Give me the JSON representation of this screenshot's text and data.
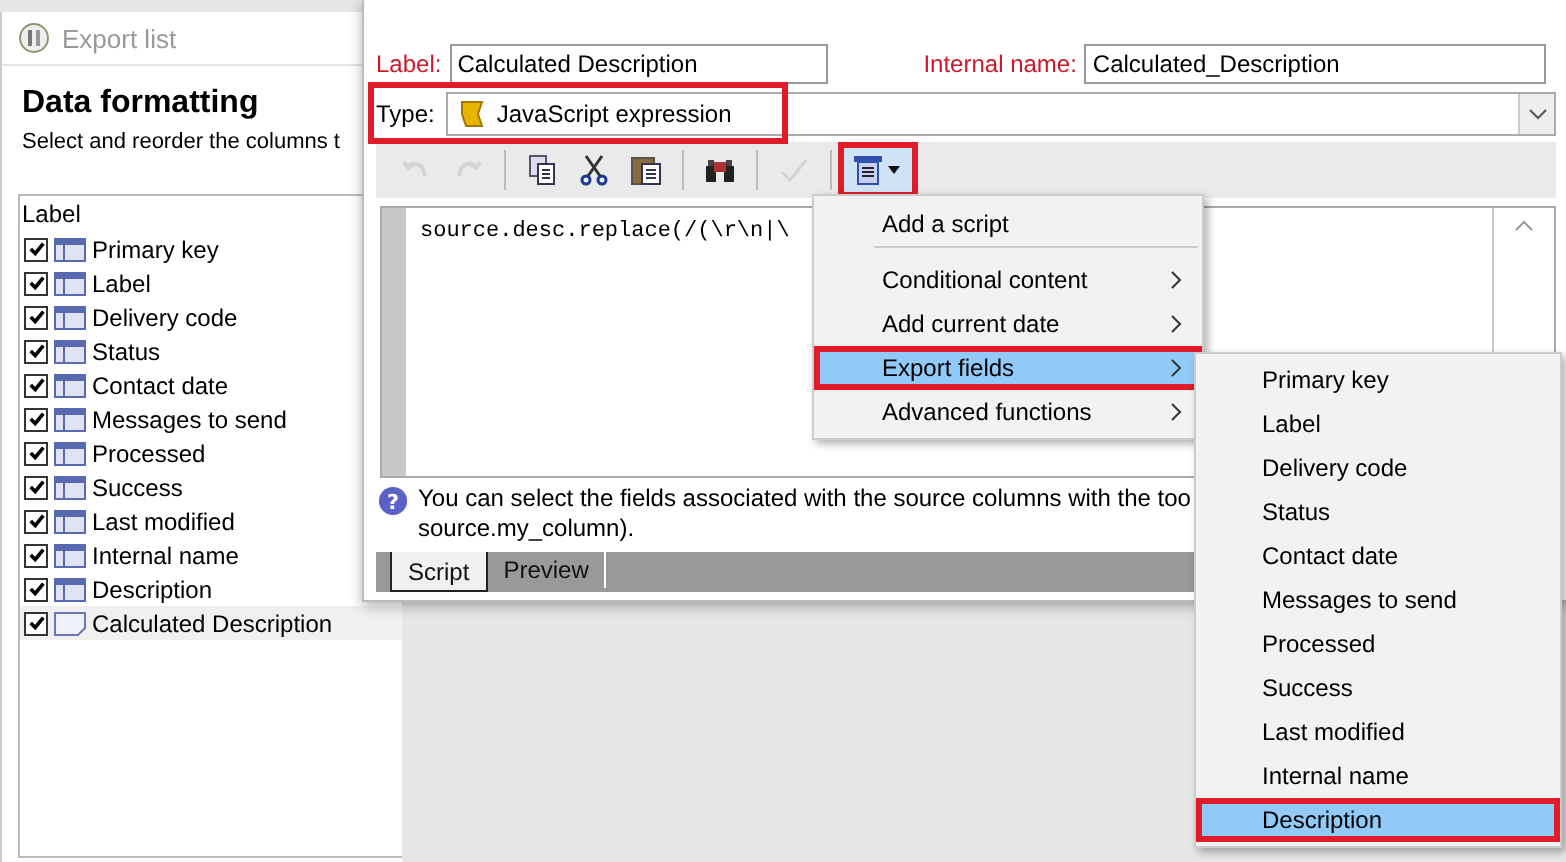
{
  "export_list": {
    "title": "Export list",
    "heading": "Data formatting",
    "subtitle": "Select and reorder the columns t",
    "column_header": "Label",
    "columns": [
      {
        "label": "Primary key",
        "checked": true,
        "kind": "column",
        "selected": false
      },
      {
        "label": "Label",
        "checked": true,
        "kind": "column",
        "selected": false
      },
      {
        "label": "Delivery code",
        "checked": true,
        "kind": "column",
        "selected": false
      },
      {
        "label": "Status",
        "checked": true,
        "kind": "column",
        "selected": false
      },
      {
        "label": "Contact date",
        "checked": true,
        "kind": "column",
        "selected": false
      },
      {
        "label": "Messages to send",
        "checked": true,
        "kind": "column",
        "selected": false
      },
      {
        "label": "Processed",
        "checked": true,
        "kind": "column",
        "selected": false
      },
      {
        "label": "Success",
        "checked": true,
        "kind": "column",
        "selected": false
      },
      {
        "label": "Last modified",
        "checked": true,
        "kind": "column",
        "selected": false
      },
      {
        "label": "Internal name",
        "checked": true,
        "kind": "column",
        "selected": false
      },
      {
        "label": "Description",
        "checked": true,
        "kind": "column",
        "selected": false
      },
      {
        "label": "Calculated Description",
        "checked": true,
        "kind": "calculated",
        "selected": true
      }
    ]
  },
  "dialog": {
    "label_caption": "Label:",
    "label_value": "Calculated Description",
    "internal_name_caption": "Internal name:",
    "internal_name_value": "Calculated_Description",
    "type": {
      "caption": "Type:",
      "value": "JavaScript expression",
      "annotated": true
    },
    "toolbar": [
      {
        "kind": "undo",
        "disabled": true,
        "annotated": false
      },
      {
        "kind": "redo",
        "disabled": true,
        "annotated": false
      },
      {
        "kind": "copy",
        "disabled": false,
        "annotated": false
      },
      {
        "kind": "cut",
        "disabled": false,
        "annotated": false
      },
      {
        "kind": "paste",
        "disabled": false,
        "annotated": false
      },
      {
        "kind": "find",
        "disabled": false,
        "annotated": false
      },
      {
        "kind": "check",
        "disabled": true,
        "annotated": false
      },
      {
        "kind": "insert",
        "disabled": false,
        "annotated": true
      }
    ],
    "code": "source.desc.replace(/(\\r\\n|\\",
    "help_icon": "?",
    "help_line_1": "You can select the fields associated with the source columns with the too",
    "help_line_2": "source.my_column).",
    "tabs": [
      {
        "label": "Script",
        "selected": true
      },
      {
        "label": "Preview",
        "selected": false
      }
    ]
  },
  "menu": [
    {
      "label": "Add a script",
      "submenu": false,
      "selected": false,
      "annotated": false,
      "separator_after": true
    },
    {
      "label": "Conditional content",
      "submenu": true,
      "selected": false,
      "annotated": false,
      "separator_after": false
    },
    {
      "label": "Add current date",
      "submenu": true,
      "selected": false,
      "annotated": false,
      "separator_after": false
    },
    {
      "label": "Export fields",
      "submenu": true,
      "selected": true,
      "annotated": true,
      "separator_after": false
    },
    {
      "label": "Advanced functions",
      "submenu": true,
      "selected": false,
      "annotated": false,
      "separator_after": false
    }
  ],
  "submenu": [
    {
      "label": "Primary key",
      "selected": false,
      "annotated": false
    },
    {
      "label": "Label",
      "selected": false,
      "annotated": false
    },
    {
      "label": "Delivery code",
      "selected": false,
      "annotated": false
    },
    {
      "label": "Status",
      "selected": false,
      "annotated": false
    },
    {
      "label": "Contact date",
      "selected": false,
      "annotated": false
    },
    {
      "label": "Messages to send",
      "selected": false,
      "annotated": false
    },
    {
      "label": "Processed",
      "selected": false,
      "annotated": false
    },
    {
      "label": "Success",
      "selected": false,
      "annotated": false
    },
    {
      "label": "Last modified",
      "selected": false,
      "annotated": false
    },
    {
      "label": "Internal name",
      "selected": false,
      "annotated": false
    },
    {
      "label": "Description",
      "selected": true,
      "annotated": true
    }
  ]
}
